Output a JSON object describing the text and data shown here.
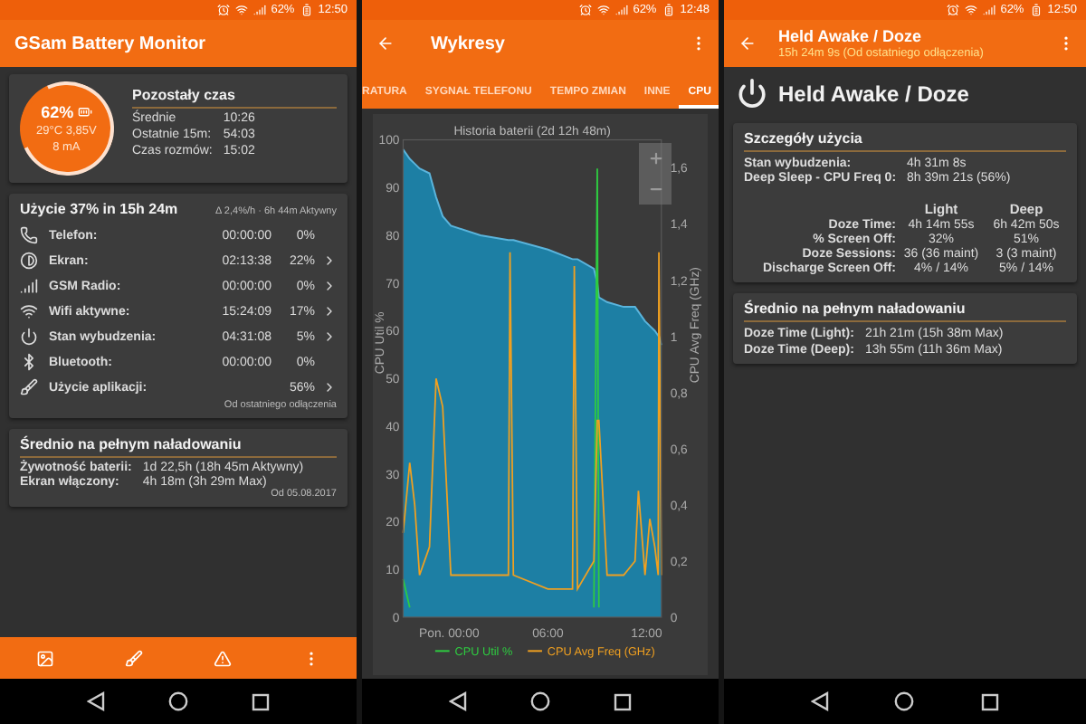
{
  "overview_screen": {
    "status_bar": {
      "battery": "62%",
      "time": "12:50"
    },
    "title": "GSam Battery Monitor",
    "battery_card": {
      "percent": "62%",
      "temp_voltage": "29°C  3,85V",
      "current": "8 mA",
      "heading": "Pozostały czas",
      "rows": [
        {
          "label": "Średnie",
          "value": "10:26"
        },
        {
          "label": "Ostatnie 15m:",
          "value": "54:03"
        },
        {
          "label": "Czas rozmów:",
          "value": "15:02"
        }
      ]
    },
    "usage_card": {
      "title": "Użycie 37% in 15h 24m",
      "rate": "Δ 2,4%/h · 6h 44m Aktywny",
      "footer": "Od ostatniego odłączenia",
      "rows": [
        {
          "label": "Telefon:",
          "time": "00:00:00",
          "percent": "0%",
          "chevron": false
        },
        {
          "label": "Ekran:",
          "time": "02:13:38",
          "percent": "22%",
          "chevron": true
        },
        {
          "label": "GSM Radio:",
          "time": "00:00:00",
          "percent": "0%",
          "chevron": true
        },
        {
          "label": "Wifi aktywne:",
          "time": "15:24:09",
          "percent": "17%",
          "chevron": true
        },
        {
          "label": "Stan wybudzenia:",
          "time": "04:31:08",
          "percent": "5%",
          "chevron": true
        },
        {
          "label": "Bluetooth:",
          "time": "00:00:00",
          "percent": "0%",
          "chevron": false
        },
        {
          "label": "Użycie aplikacji:",
          "percent": "56%",
          "chevron": true
        }
      ]
    },
    "average_card": {
      "title": "Średnio na pełnym naładowaniu",
      "footer": "Od 05.08.2017",
      "rows": [
        {
          "label": "Żywotność baterii:",
          "value": "1d 22,5h (18h 45m Aktywny)"
        },
        {
          "label": "Ekran włączony:",
          "value": "4h 18m (3h 29m Max)"
        }
      ]
    }
  },
  "charts_screen": {
    "status_bar": {
      "battery": "62%",
      "time": "12:48"
    },
    "title": "Wykresy",
    "tabs": [
      {
        "label": "RATURA",
        "selected": false
      },
      {
        "label": "SYGNAŁ TELEFONU",
        "selected": false
      },
      {
        "label": "TEMPO ZMIAN",
        "selected": false
      },
      {
        "label": "INNE",
        "selected": false
      },
      {
        "label": "CPU",
        "selected": true
      }
    ],
    "chart_data": {
      "type": "line",
      "title": "Historia baterii (2d 12h 48m)",
      "ylabel": "CPU Util %",
      "y2label": "CPU Avg Freq (GHz)",
      "x": [
        -2.8,
        -2.4,
        -2.1,
        -1.8,
        -1.2,
        -0.8,
        -0.4,
        0.1,
        1.9,
        3.6,
        3.7,
        3.9,
        6.0,
        7.5,
        7.6,
        7.8,
        8.8,
        9.0,
        9.1,
        9.6,
        10.6,
        11.3,
        11.5,
        11.9,
        12.2,
        12.5,
        12.7,
        12.75,
        12.9
      ],
      "xlim": [
        -2.8,
        12.9
      ],
      "ylim": [
        0,
        100
      ],
      "y2lim": [
        0,
        1.7
      ],
      "legend": "bottom",
      "xticks": [
        {
          "value": 0,
          "label": "Pon. 00:00"
        },
        {
          "value": 6,
          "label": "06:00"
        },
        {
          "value": 12,
          "label": "12:00"
        }
      ],
      "yticks": [
        0,
        10,
        20,
        30,
        40,
        50,
        60,
        70,
        80,
        90,
        100
      ],
      "y2ticks": [
        {
          "value": 0,
          "label": "0"
        },
        {
          "value": 0.2,
          "label": "0,2"
        },
        {
          "value": 0.4,
          "label": "0,4"
        },
        {
          "value": 0.6,
          "label": "0,6"
        },
        {
          "value": 0.8,
          "label": "0,8"
        },
        {
          "value": 1,
          "label": "1"
        },
        {
          "value": 1.2,
          "label": "1,2"
        },
        {
          "value": 1.4,
          "label": "1,4"
        },
        {
          "value": 1.6,
          "label": "1,6"
        }
      ],
      "series": [
        {
          "type": "area",
          "color": "#5ab4dc",
          "values": [
            98,
            96,
            95,
            94,
            93,
            88,
            84,
            82,
            80,
            79,
            79,
            79,
            77,
            75,
            75,
            75,
            73,
            70,
            67,
            66,
            65,
            65,
            64,
            62,
            61,
            60,
            59,
            59,
            57
          ]
        },
        {
          "name": "CPU Util %",
          "color": "#2ecc40",
          "values": [
            8,
            2,
            null,
            null,
            null,
            null,
            null,
            null,
            null,
            null,
            null,
            null,
            null,
            null,
            null,
            null,
            2,
            94,
            2,
            null,
            null,
            null,
            null,
            null,
            null,
            null,
            null,
            null,
            null
          ]
        },
        {
          "axis": "y2",
          "name": "CPU Avg Freq (GHz)",
          "color": "#f0a020",
          "values": [
            0.3,
            0.55,
            0.4,
            0.15,
            0.25,
            0.85,
            0.75,
            0.15,
            0.15,
            0.15,
            1.3,
            0.15,
            0.1,
            0.1,
            1.25,
            0.1,
            0.2,
            0.7,
            0.7,
            0.15,
            0.15,
            0.2,
            0.45,
            0.15,
            0.35,
            0.25,
            0.15,
            1.3,
            0.15
          ]
        }
      ]
    }
  },
  "doze_screen": {
    "status_bar": {
      "battery": "62%",
      "time": "12:50"
    },
    "title": "Held Awake / Doze",
    "subtitle": "15h 24m 9s (Od ostatniego odłączenia)",
    "heading": "Held Awake / Doze",
    "details_card": {
      "title": "Szczegóły użycia",
      "rows": [
        {
          "label": "Stan wybudzenia:",
          "value": "4h 31m 8s"
        },
        {
          "label": "Deep Sleep - CPU Freq 0:",
          "value": "8h 39m 21s (56%)"
        }
      ],
      "columns": [
        "Light",
        "Deep"
      ],
      "table": [
        {
          "label": "Doze Time:",
          "light": "4h 14m 55s",
          "deep": "6h 42m 50s"
        },
        {
          "label": "% Screen Off:",
          "light": "32%",
          "deep": "51%"
        },
        {
          "label": "Doze Sessions:",
          "light": "36 (36 maint)",
          "deep": "3 (3 maint)"
        },
        {
          "label": "Discharge Screen Off:",
          "light": "4% / 14%",
          "deep": "5% / 14%"
        }
      ]
    },
    "average_card": {
      "title": "Średnio na pełnym naładowaniu",
      "rows": [
        {
          "label": "Doze Time (Light):",
          "value": "21h 21m (15h 38m Max)"
        },
        {
          "label": "Doze Time (Deep):",
          "value": "13h 55m (11h 36m Max)"
        }
      ]
    }
  }
}
